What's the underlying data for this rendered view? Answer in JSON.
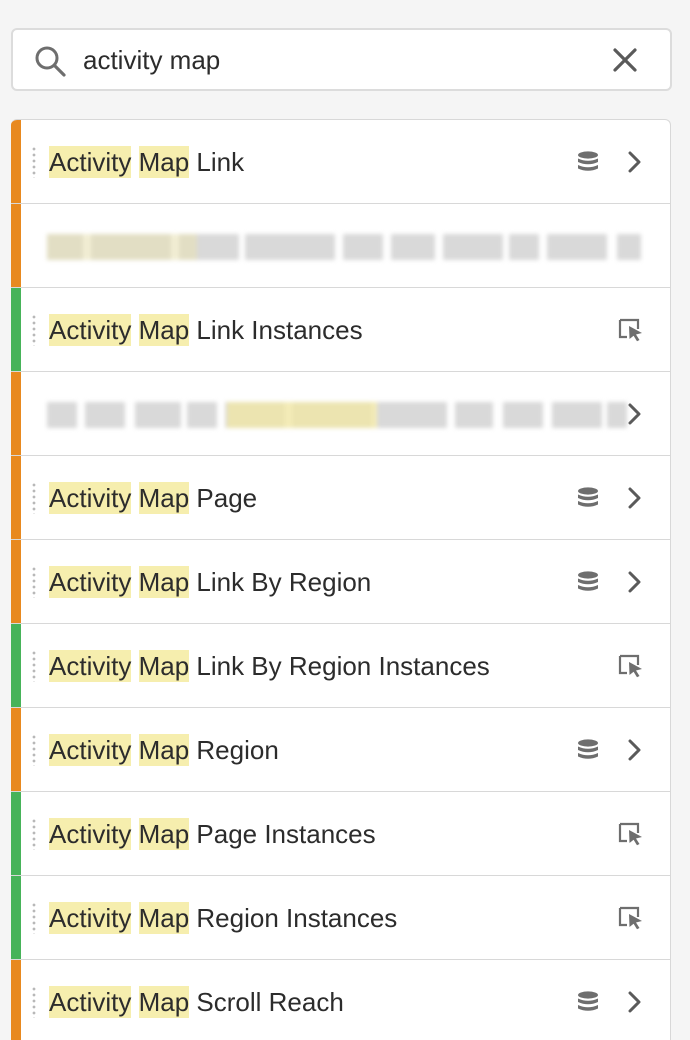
{
  "search": {
    "value": "activity map",
    "placeholder": ""
  },
  "colors": {
    "dimension": "#e8891f",
    "metric": "#46b359",
    "highlight": "#f6eeae"
  },
  "rows": [
    {
      "highlight1": "Activity",
      "highlight2": "Map",
      "rest": "Link",
      "kind": "dimension",
      "icon": "database-icon",
      "chevron": true
    },
    {
      "redacted": true,
      "kind": "dimension"
    },
    {
      "highlight1": "Activity",
      "highlight2": "Map",
      "rest": "Link Instances",
      "kind": "metric",
      "icon": "instances-cursor-icon",
      "chevron": false
    },
    {
      "redacted": true,
      "kind": "dimension"
    },
    {
      "highlight1": "Activity",
      "highlight2": "Map",
      "rest": "Page",
      "kind": "dimension",
      "icon": "database-icon",
      "chevron": true
    },
    {
      "highlight1": "Activity",
      "highlight2": "Map",
      "rest": "Link By Region",
      "kind": "dimension",
      "icon": "database-icon",
      "chevron": true
    },
    {
      "highlight1": "Activity",
      "highlight2": "Map",
      "rest": "Link By Region Instances",
      "kind": "metric",
      "icon": "instances-cursor-icon",
      "chevron": false
    },
    {
      "highlight1": "Activity",
      "highlight2": "Map",
      "rest": "Region",
      "kind": "dimension",
      "icon": "database-icon",
      "chevron": true
    },
    {
      "highlight1": "Activity",
      "highlight2": "Map",
      "rest": "Page Instances",
      "kind": "metric",
      "icon": "instances-cursor-icon",
      "chevron": false
    },
    {
      "highlight1": "Activity",
      "highlight2": "Map",
      "rest": "Region Instances",
      "kind": "metric",
      "icon": "instances-cursor-icon",
      "chevron": false
    },
    {
      "highlight1": "Activity",
      "highlight2": "Map",
      "rest": "Scroll Reach",
      "kind": "dimension",
      "icon": "database-icon",
      "chevron": true
    }
  ]
}
